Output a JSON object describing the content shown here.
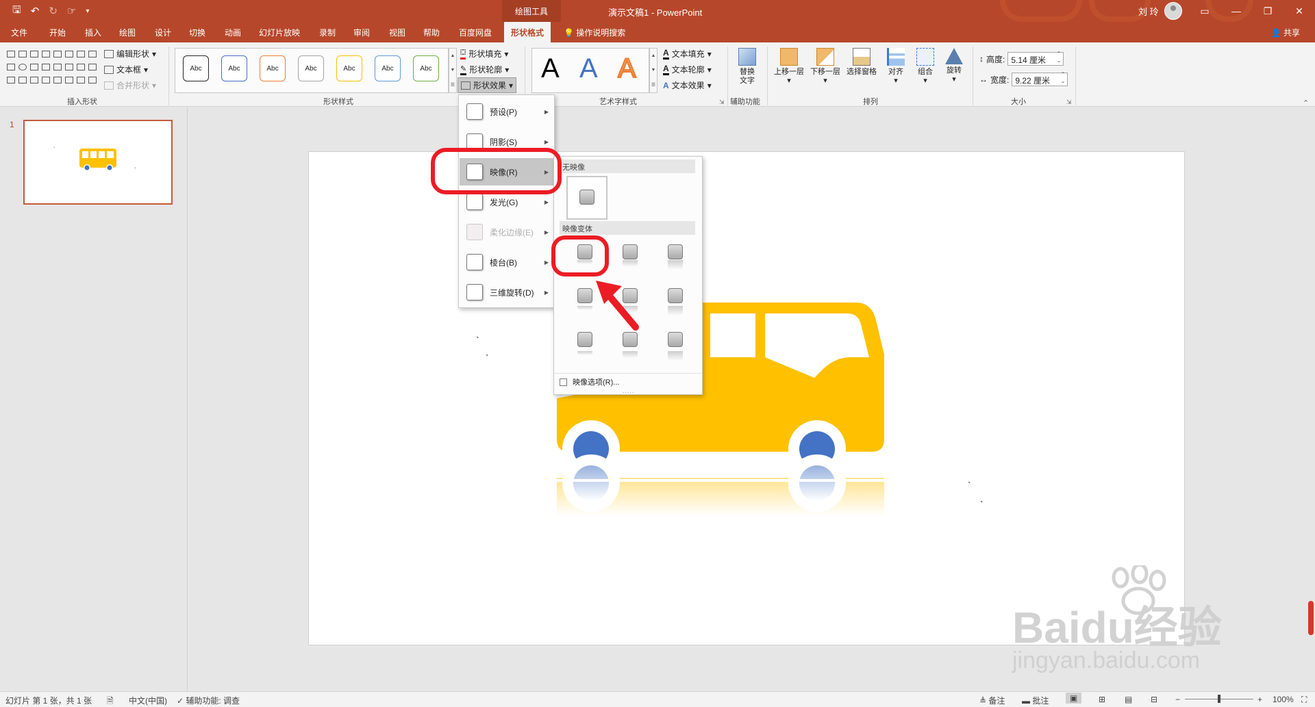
{
  "titlebar": {
    "context_tab": "绘图工具",
    "title": "演示文稿1  -  PowerPoint",
    "user": "刘 玲",
    "qat": {
      "save": "🖫",
      "undo": "↶",
      "redo": "↻",
      "more": "▾"
    },
    "controls": {
      "ribbon_display": "▭",
      "minimize": "—",
      "restore": "❐",
      "close": "✕"
    }
  },
  "tabs": [
    "文件",
    "开始",
    "插入",
    "绘图",
    "设计",
    "切换",
    "动画",
    "幻灯片放映",
    "录制",
    "审阅",
    "视图",
    "帮助",
    "百度网盘",
    "形状格式"
  ],
  "tell_me": "操作说明搜索",
  "share": "共享",
  "ribbon": {
    "insert_shapes": {
      "label": "插入形状",
      "edit_shape": "编辑形状",
      "text_box": "文本框",
      "merge_shapes": "合并形状"
    },
    "shape_styles": {
      "label": "形状样式",
      "preview_text": "Abc",
      "fill": "形状填充",
      "outline": "形状轮廓",
      "effects": "形状效果",
      "box_colors": [
        "#262626",
        "#4472c4",
        "#ed7d31",
        "#a5a5a5",
        "#ffc000",
        "#5b9bd5",
        "#70ad47"
      ]
    },
    "wordart": {
      "label": "艺术字样式",
      "letter": "A",
      "text_fill": "文本填充",
      "text_outline": "文本轮廓",
      "text_effects": "文本效果"
    },
    "accessibility": {
      "label": "辅助功能",
      "alt_text_line1": "替换",
      "alt_text_line2": "文字"
    },
    "arrange": {
      "label": "排列",
      "bring_forward": "上移一层",
      "send_backward": "下移一层",
      "selection_pane": "选择窗格",
      "align": "对齐",
      "group": "组合",
      "rotate": "旋转"
    },
    "size": {
      "label": "大小",
      "height_label": "高度:",
      "height_value": "5.14 厘米",
      "width_label": "宽度:",
      "width_value": "9.22 厘米"
    }
  },
  "effects_menu": {
    "items": [
      {
        "label": "预设(P)",
        "disabled": false
      },
      {
        "label": "阴影(S)",
        "disabled": false
      },
      {
        "label": "映像(R)",
        "disabled": false
      },
      {
        "label": "发光(G)",
        "disabled": false
      },
      {
        "label": "柔化边缘(E)",
        "disabled": true
      },
      {
        "label": "棱台(B)",
        "disabled": false
      },
      {
        "label": "三维旋转(D)",
        "disabled": false
      }
    ]
  },
  "reflection_panel": {
    "no_reflection": "无映像",
    "variants": "映像变体",
    "options": "映像选项(R)...",
    "grip": "....."
  },
  "thumbnail": {
    "number": "1"
  },
  "statusbar": {
    "slide_info": "幻灯片 第 1 张，共 1 张",
    "language": "中文(中国)",
    "accessibility": "辅助功能: 调查",
    "notes": "备注",
    "comments": "批注",
    "zoom_minus": "−",
    "zoom_plus": "+",
    "zoom": "100%"
  },
  "watermark": {
    "brand": "Baidu经验",
    "url": "jingyan.baidu.com"
  },
  "colors": {
    "accent": "#b7472a",
    "bus_body": "#ffc000",
    "bus_wheel": "#4472c4",
    "highlight_ring": "#ec1c24"
  }
}
